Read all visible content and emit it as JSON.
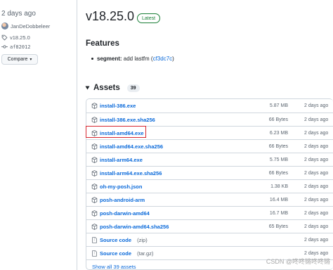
{
  "sidebar": {
    "date": "2 days ago",
    "author": "JanDeDobbeleer",
    "tag": "v18.25.0",
    "commit": "af82012",
    "compare_label": "Compare"
  },
  "release": {
    "title": "v18.25.0",
    "badge": "Latest",
    "features_heading": "Features",
    "feature": {
      "scope": "segment:",
      "text": " add lastfm (",
      "link": "cf3dc7c",
      "close": ")"
    }
  },
  "assets": {
    "heading": "Assets",
    "count": "39",
    "items": [
      {
        "name": "install-386.exe",
        "size": "5.87 MB",
        "date": "2 days ago",
        "kind": "package"
      },
      {
        "name": "install-386.exe.sha256",
        "size": "66 Bytes",
        "date": "2 days ago",
        "kind": "package"
      },
      {
        "name": "install-amd64.exe",
        "size": "6.23 MB",
        "date": "2 days ago",
        "kind": "package"
      },
      {
        "name": "install-amd64.exe.sha256",
        "size": "66 Bytes",
        "date": "2 days ago",
        "kind": "package"
      },
      {
        "name": "install-arm64.exe",
        "size": "5.75 MB",
        "date": "2 days ago",
        "kind": "package"
      },
      {
        "name": "install-arm64.exe.sha256",
        "size": "66 Bytes",
        "date": "2 days ago",
        "kind": "package"
      },
      {
        "name": "oh-my-posh.json",
        "size": "1.38 KB",
        "date": "2 days ago",
        "kind": "package"
      },
      {
        "name": "posh-android-arm",
        "size": "16.4 MB",
        "date": "2 days ago",
        "kind": "package"
      },
      {
        "name": "posh-darwin-amd64",
        "size": "16.7 MB",
        "date": "2 days ago",
        "kind": "package"
      },
      {
        "name": "posh-darwin-amd64.sha256",
        "size": "65 Bytes",
        "date": "2 days ago",
        "kind": "package"
      },
      {
        "name": "Source code",
        "suffix": "(zip)",
        "size": "",
        "date": "2 days ago",
        "kind": "zip"
      },
      {
        "name": "Source code",
        "suffix": "(tar.gz)",
        "size": "",
        "date": "2 days ago",
        "kind": "zip"
      }
    ],
    "show_all": "Show all 39 assets"
  },
  "watermark": "CSDN @咚咚锵咚咚锵",
  "colors": {
    "link": "#0969da",
    "latest_green": "#1a7f37",
    "highlight_red": "#d6272f"
  }
}
